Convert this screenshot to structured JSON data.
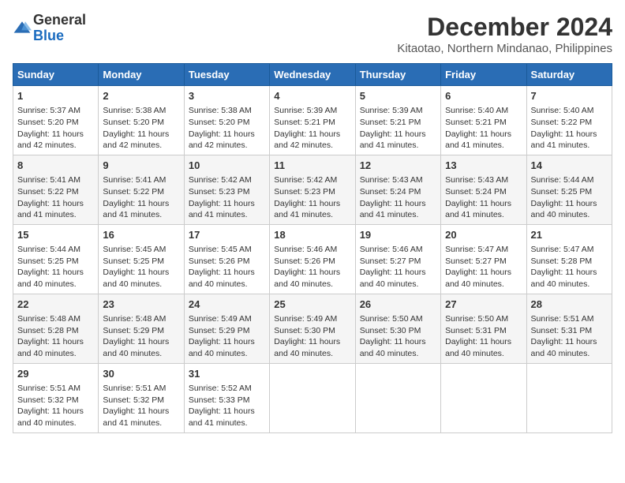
{
  "logo": {
    "line1": "General",
    "line2": "Blue"
  },
  "title": "December 2024",
  "subtitle": "Kitaotao, Northern Mindanao, Philippines",
  "days_header": [
    "Sunday",
    "Monday",
    "Tuesday",
    "Wednesday",
    "Thursday",
    "Friday",
    "Saturday"
  ],
  "weeks": [
    [
      {
        "day": "1",
        "info": "Sunrise: 5:37 AM\nSunset: 5:20 PM\nDaylight: 11 hours\nand 42 minutes."
      },
      {
        "day": "2",
        "info": "Sunrise: 5:38 AM\nSunset: 5:20 PM\nDaylight: 11 hours\nand 42 minutes."
      },
      {
        "day": "3",
        "info": "Sunrise: 5:38 AM\nSunset: 5:20 PM\nDaylight: 11 hours\nand 42 minutes."
      },
      {
        "day": "4",
        "info": "Sunrise: 5:39 AM\nSunset: 5:21 PM\nDaylight: 11 hours\nand 42 minutes."
      },
      {
        "day": "5",
        "info": "Sunrise: 5:39 AM\nSunset: 5:21 PM\nDaylight: 11 hours\nand 41 minutes."
      },
      {
        "day": "6",
        "info": "Sunrise: 5:40 AM\nSunset: 5:21 PM\nDaylight: 11 hours\nand 41 minutes."
      },
      {
        "day": "7",
        "info": "Sunrise: 5:40 AM\nSunset: 5:22 PM\nDaylight: 11 hours\nand 41 minutes."
      }
    ],
    [
      {
        "day": "8",
        "info": "Sunrise: 5:41 AM\nSunset: 5:22 PM\nDaylight: 11 hours\nand 41 minutes."
      },
      {
        "day": "9",
        "info": "Sunrise: 5:41 AM\nSunset: 5:22 PM\nDaylight: 11 hours\nand 41 minutes."
      },
      {
        "day": "10",
        "info": "Sunrise: 5:42 AM\nSunset: 5:23 PM\nDaylight: 11 hours\nand 41 minutes."
      },
      {
        "day": "11",
        "info": "Sunrise: 5:42 AM\nSunset: 5:23 PM\nDaylight: 11 hours\nand 41 minutes."
      },
      {
        "day": "12",
        "info": "Sunrise: 5:43 AM\nSunset: 5:24 PM\nDaylight: 11 hours\nand 41 minutes."
      },
      {
        "day": "13",
        "info": "Sunrise: 5:43 AM\nSunset: 5:24 PM\nDaylight: 11 hours\nand 41 minutes."
      },
      {
        "day": "14",
        "info": "Sunrise: 5:44 AM\nSunset: 5:25 PM\nDaylight: 11 hours\nand 40 minutes."
      }
    ],
    [
      {
        "day": "15",
        "info": "Sunrise: 5:44 AM\nSunset: 5:25 PM\nDaylight: 11 hours\nand 40 minutes."
      },
      {
        "day": "16",
        "info": "Sunrise: 5:45 AM\nSunset: 5:25 PM\nDaylight: 11 hours\nand 40 minutes."
      },
      {
        "day": "17",
        "info": "Sunrise: 5:45 AM\nSunset: 5:26 PM\nDaylight: 11 hours\nand 40 minutes."
      },
      {
        "day": "18",
        "info": "Sunrise: 5:46 AM\nSunset: 5:26 PM\nDaylight: 11 hours\nand 40 minutes."
      },
      {
        "day": "19",
        "info": "Sunrise: 5:46 AM\nSunset: 5:27 PM\nDaylight: 11 hours\nand 40 minutes."
      },
      {
        "day": "20",
        "info": "Sunrise: 5:47 AM\nSunset: 5:27 PM\nDaylight: 11 hours\nand 40 minutes."
      },
      {
        "day": "21",
        "info": "Sunrise: 5:47 AM\nSunset: 5:28 PM\nDaylight: 11 hours\nand 40 minutes."
      }
    ],
    [
      {
        "day": "22",
        "info": "Sunrise: 5:48 AM\nSunset: 5:28 PM\nDaylight: 11 hours\nand 40 minutes."
      },
      {
        "day": "23",
        "info": "Sunrise: 5:48 AM\nSunset: 5:29 PM\nDaylight: 11 hours\nand 40 minutes."
      },
      {
        "day": "24",
        "info": "Sunrise: 5:49 AM\nSunset: 5:29 PM\nDaylight: 11 hours\nand 40 minutes."
      },
      {
        "day": "25",
        "info": "Sunrise: 5:49 AM\nSunset: 5:30 PM\nDaylight: 11 hours\nand 40 minutes."
      },
      {
        "day": "26",
        "info": "Sunrise: 5:50 AM\nSunset: 5:30 PM\nDaylight: 11 hours\nand 40 minutes."
      },
      {
        "day": "27",
        "info": "Sunrise: 5:50 AM\nSunset: 5:31 PM\nDaylight: 11 hours\nand 40 minutes."
      },
      {
        "day": "28",
        "info": "Sunrise: 5:51 AM\nSunset: 5:31 PM\nDaylight: 11 hours\nand 40 minutes."
      }
    ],
    [
      {
        "day": "29",
        "info": "Sunrise: 5:51 AM\nSunset: 5:32 PM\nDaylight: 11 hours\nand 40 minutes."
      },
      {
        "day": "30",
        "info": "Sunrise: 5:51 AM\nSunset: 5:32 PM\nDaylight: 11 hours\nand 41 minutes."
      },
      {
        "day": "31",
        "info": "Sunrise: 5:52 AM\nSunset: 5:33 PM\nDaylight: 11 hours\nand 41 minutes."
      },
      {
        "day": "",
        "info": ""
      },
      {
        "day": "",
        "info": ""
      },
      {
        "day": "",
        "info": ""
      },
      {
        "day": "",
        "info": ""
      }
    ]
  ]
}
